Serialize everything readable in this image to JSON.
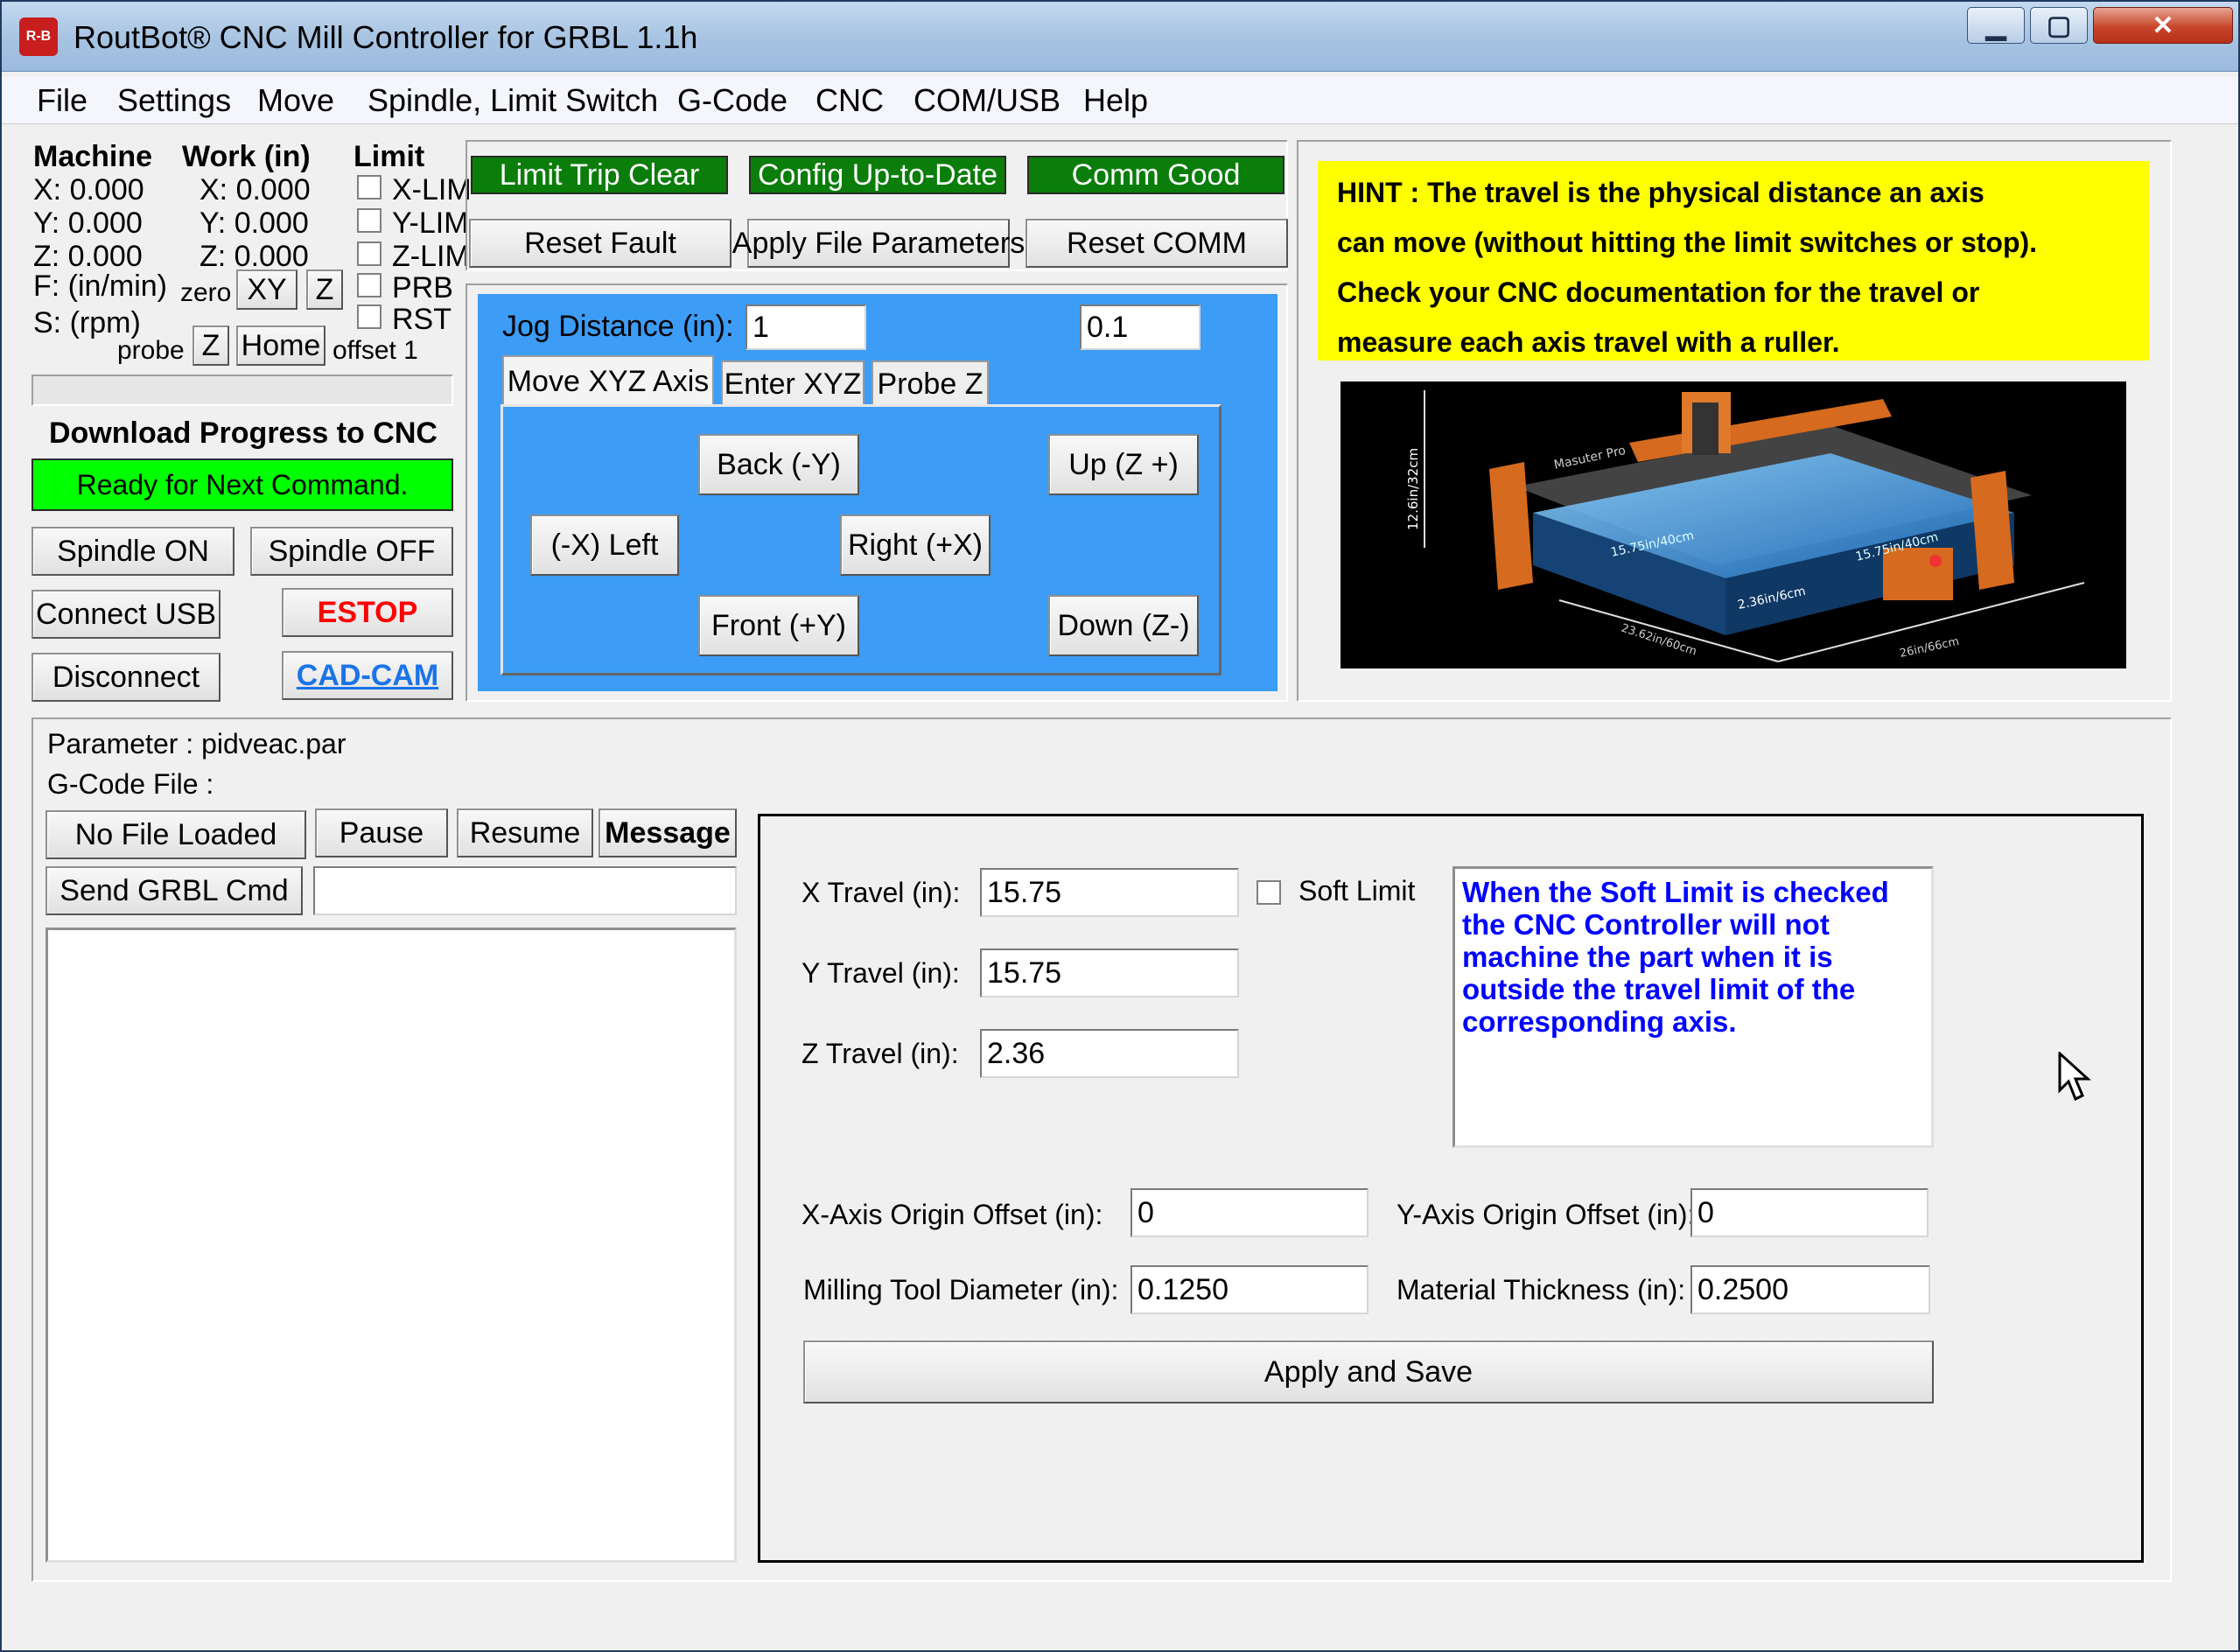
{
  "window": {
    "title": "RoutBot® CNC Mill Controller for GRBL 1.1h",
    "app_icon_text": "R-B",
    "min": "▁",
    "max": "▢",
    "close": "✕"
  },
  "menu": [
    "File",
    "Settings",
    "Move",
    "Spindle, Limit Switch",
    "G-Code",
    "CNC",
    "COM/USB",
    "Help"
  ],
  "coords": {
    "machine_header": "Machine",
    "work_header": "Work (in)",
    "limit_header": "Limit",
    "machine": [
      "X: 0.000",
      "Y: 0.000",
      "Z: 0.000"
    ],
    "work": [
      "X: 0.000",
      "Y: 0.000",
      "Z: 0.000"
    ],
    "feed": "F: (in/min)",
    "speed": "S: (rpm)",
    "zero_label": "zero",
    "zero_xy": "XY",
    "zero_z": "Z",
    "probe_label": "probe",
    "probe_z": "Z",
    "home": "Home",
    "offset": "offset 1",
    "limits": [
      "X-LIM",
      "Y-LIM",
      "Z-LIM",
      "PRB",
      "RST"
    ]
  },
  "status": {
    "limit": "Limit Trip Clear",
    "config": "Config Up-to-Date",
    "comm": "Comm Good"
  },
  "actions": {
    "reset_fault": "Reset Fault",
    "apply_file_params": "Apply File Parameters",
    "reset_comm": "Reset COMM"
  },
  "progress": {
    "title": "Download Progress to CNC",
    "state": "Ready for Next Command."
  },
  "control": {
    "spindle_on": "Spindle ON",
    "spindle_off": "Spindle OFF",
    "connect": "Connect USB",
    "estop": "ESTOP",
    "disconnect": "Disconnect",
    "cadcam": "CAD-CAM"
  },
  "jog": {
    "distance_label": "Jog Distance (in):",
    "distance_value": "1",
    "distance_alt": "0.1",
    "tabs": [
      "Move XYZ Axis",
      "Enter XYZ",
      "Probe Z"
    ],
    "back": "Back  (-Y)",
    "up": "Up (Z +)",
    "left": "(-X) Left",
    "right": "Right  (+X)",
    "front": "Front  (+Y)",
    "down": "Down (Z-)"
  },
  "hint": {
    "lines": [
      "HINT : The travel is the physical distance an axis",
      "can move (without hitting the limit switches or stop).",
      "Check your CNC documentation for the travel or",
      "measure each axis travel with a ruller."
    ],
    "photo": {
      "brand": "Masuter Pro",
      "dim_height": "12.6in/32cm",
      "dim_x": "15.75in/40cm",
      "dim_y": "15.75in/40cm",
      "dim_z": "2.36in/6cm",
      "dim_depth": "23.62in/60cm",
      "dim_width": "26in/66cm"
    }
  },
  "file": {
    "parameter": "Parameter : pidveac.par",
    "gcode": "G-Code File :",
    "no_file": "No File Loaded",
    "pause": "Pause",
    "resume": "Resume",
    "message": "Message",
    "send": "Send GRBL Cmd",
    "cmd_value": ""
  },
  "settings": {
    "x_label": "X Travel (in):",
    "x_value": "15.75",
    "y_label": "Y Travel (in):",
    "y_value": "15.75",
    "z_label": "Z Travel (in):",
    "z_value": "2.36",
    "soft_limit": "Soft Limit",
    "note": "When the Soft Limit is checked the CNC Controller will not machine the part when it is outside the travel limit of the corresponding axis.",
    "x_off_label": "X-Axis Origin Offset (in):",
    "x_off_value": "0",
    "y_off_label": "Y-Axis Origin Offset (in):",
    "y_off_value": "0",
    "tool_label": "Milling Tool  Diameter (in):",
    "tool_value": "0.1250",
    "thick_label": "Material Thickness (in):",
    "thick_value": "0.2500",
    "apply": "Apply and Save"
  },
  "colors": {
    "status_green": "#0a7d0a",
    "ready_green": "#00ff00",
    "jog_blue": "#3c9cf6",
    "hint_yellow": "#ffff00",
    "estop_red": "#ff0000",
    "cadcam_blue": "#1a73e8",
    "note_blue": "#0000ff"
  }
}
